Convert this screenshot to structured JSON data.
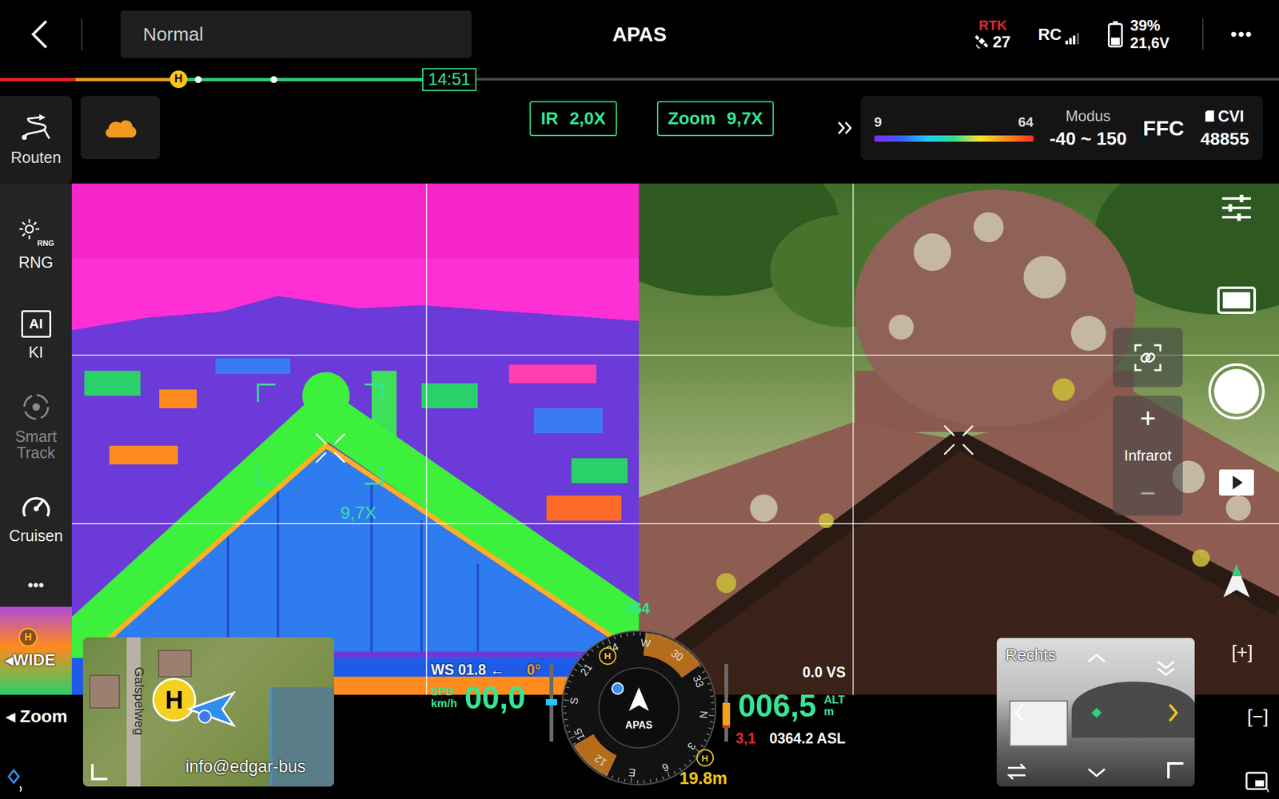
{
  "top_bar": {
    "mode": "Normal",
    "title": "APAS",
    "rtk": {
      "label": "RTK",
      "satellites": "27"
    },
    "rc": {
      "label": "RC",
      "signal": 0.75
    },
    "battery": {
      "percent": "39%",
      "voltage": "21,6V",
      "level": 0.39
    },
    "more": "•••"
  },
  "timeline": {
    "segments": [
      {
        "color": "#e8262b",
        "level": 0.059
      },
      {
        "color": "#f5a21b",
        "level": 0.08
      },
      {
        "color": "#2fd27a",
        "level": 0.191
      }
    ],
    "home": "H",
    "waypoints": [
      0.07,
      0.38
    ],
    "time": "14:51"
  },
  "toolbar": {
    "routes": "Routen",
    "weather_alert": true,
    "ir_zoom": {
      "label": "IR",
      "value": "2,0X"
    },
    "zoom": {
      "label": "Zoom",
      "value": "9,7X"
    }
  },
  "palette": {
    "min": "9",
    "max": "64",
    "mode_label": "Modus",
    "range": "-40 ~ 150",
    "ffc": "FFC",
    "storage": "CVI",
    "count": "48855"
  },
  "sidebar": [
    {
      "kind": "rng",
      "badge": "RNG",
      "label": "RNG",
      "disabled": false
    },
    {
      "kind": "ai",
      "badge": "AI",
      "label": "KI",
      "disabled": false
    },
    {
      "kind": "track",
      "label": "Smart Track",
      "disabled": true
    },
    {
      "kind": "speed",
      "label": "Cruisen",
      "disabled": false
    },
    {
      "kind": "more",
      "label": "•••",
      "disabled": false
    }
  ],
  "ir_view": {
    "zoom": "9,7X"
  },
  "camera_controls": {
    "source_label": "Infrarot",
    "plus": "+",
    "minus": "−"
  },
  "lens": {
    "arrow": "◂",
    "wide": "WIDE",
    "home": "H",
    "zoom": "Zoom"
  },
  "map": {
    "street": "Galspelweg",
    "home": "H",
    "watermark": "info@edgar-bus"
  },
  "flight": {
    "wind": "WS 01.8 ←",
    "wind_dir": "0°",
    "speed_label": "SPD",
    "speed_unit": "km/h",
    "speed": "00,0",
    "vertical_speed": "0.0 VS",
    "altitude": "006,5",
    "alt_label": "ALT",
    "alt_unit": "m",
    "alt_limit": "3,1",
    "asl": "0364.2 ASL",
    "home_label": "H",
    "home_distance": "19.8m"
  },
  "compass": {
    "heading": "264",
    "label": "APAS",
    "home": "H",
    "marks": [
      "N",
      "3",
      "6",
      "E",
      "12",
      "15",
      "S",
      "21",
      "24",
      "W",
      "30",
      "33"
    ],
    "alerts": [
      {
        "start": 5,
        "end": 55
      },
      {
        "start": 205,
        "end": 240
      }
    ]
  },
  "fpv": {
    "label": "Rechts"
  },
  "zoom_buttons": {
    "zoom_in": "[+]",
    "zoom_out": "[−]"
  }
}
